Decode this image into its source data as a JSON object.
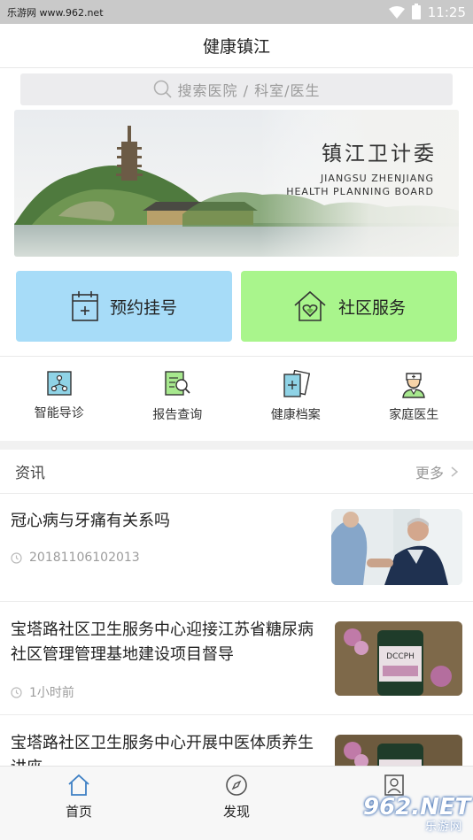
{
  "status_bar": {
    "watermark": "乐游网 www.962.net",
    "time": "11:25"
  },
  "header": {
    "title": "健康镇江"
  },
  "search": {
    "placeholder": "搜索医院 / 科室/医生"
  },
  "banner": {
    "title": "镇江卫计委",
    "subtitle_line1": "JIANGSU ZHENJIANG",
    "subtitle_line2": "HEALTH PLANNING BOARD"
  },
  "main_actions": [
    {
      "label": "预约挂号",
      "icon": "calendar-plus-icon",
      "color": "#a7dcf8"
    },
    {
      "label": "社区服务",
      "icon": "house-heart-icon",
      "color": "#a9f58c"
    }
  ],
  "quick_links": [
    {
      "label": "智能导诊",
      "icon": "smart-guide-icon"
    },
    {
      "label": "报告查询",
      "icon": "report-search-icon"
    },
    {
      "label": "健康档案",
      "icon": "health-record-icon"
    },
    {
      "label": "家庭医生",
      "icon": "family-doctor-icon"
    }
  ],
  "news_section": {
    "title": "资讯",
    "more": "更多",
    "items": [
      {
        "title": "冠心病与牙痛有关系吗",
        "time": "20181106102013",
        "thumb": "doctor-patient-image"
      },
      {
        "title": "宝塔路社区卫生服务中心迎接江苏省糖尿病社区管理管理基地建设项目督导",
        "time": "1小时前",
        "thumb": "medicine-bottle-image"
      },
      {
        "title": "宝塔路社区卫生服务中心开展中医体质养生讲座",
        "time": "",
        "thumb": "medicine-bottle-image"
      }
    ]
  },
  "tab_bar": [
    {
      "label": "首页",
      "icon": "home-icon",
      "active": true
    },
    {
      "label": "发现",
      "icon": "compass-icon",
      "active": false
    },
    {
      "label": "",
      "icon": "profile-icon",
      "active": false
    }
  ],
  "corner_watermark": {
    "brand": "962.NET",
    "sub": "乐游网"
  },
  "colors": {
    "appt_button": "#a7dcf8",
    "community_button": "#a9f58c",
    "tab_active": "#3d7fc4"
  }
}
